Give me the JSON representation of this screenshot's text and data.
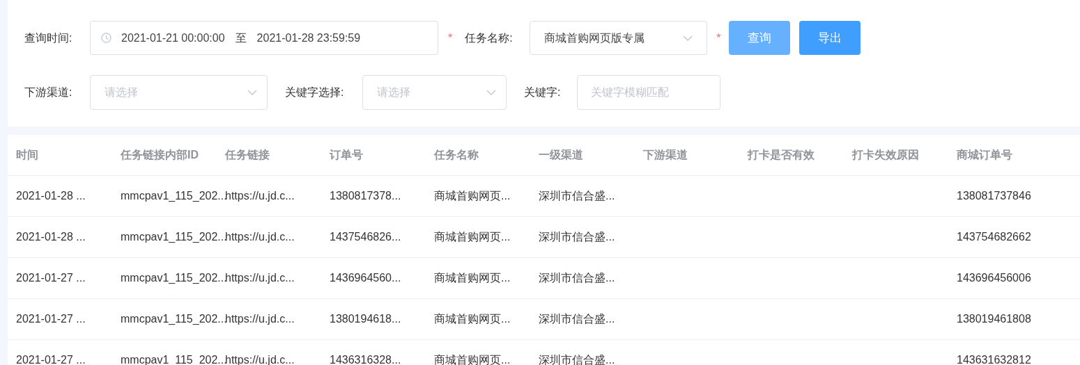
{
  "filters": {
    "time_label": "查询时间:",
    "date_start": "2021-01-21 00:00:00",
    "date_separator": "至",
    "date_end": "2021-01-28 23:59:59",
    "time_required": "*",
    "task_label": "任务名称:",
    "task_value": "商城首购网页版专属",
    "task_required": "*",
    "query_button": "查询",
    "export_button": "导出",
    "channel_label": "下游渠道:",
    "channel_placeholder": "请选择",
    "keyword_select_label": "关键字选择:",
    "keyword_select_placeholder": "请选择",
    "keyword_label": "关键字:",
    "keyword_placeholder": "关键字模糊匹配"
  },
  "table": {
    "columns": [
      "时间",
      "任务链接内部ID",
      "任务链接",
      "订单号",
      "任务名称",
      "一级渠道",
      "下游渠道",
      "打卡是否有效",
      "打卡失效原因",
      "商城订单号"
    ],
    "rows": [
      [
        "2021-01-28 ...",
        "mmcpav1_115_202...",
        "https://u.jd.c...",
        "1380817378...",
        "商城首购网页...",
        "深圳市信合盛...",
        null,
        null,
        null,
        "138081737846"
      ],
      [
        "2021-01-28 ...",
        "mmcpav1_115_202...",
        "https://u.jd.c...",
        "1437546826...",
        "商城首购网页...",
        "深圳市信合盛...",
        null,
        null,
        null,
        "143754682662"
      ],
      [
        "2021-01-27 ...",
        "mmcpav1_115_202...",
        "https://u.jd.c...",
        "1436964560...",
        "商城首购网页...",
        "深圳市信合盛...",
        null,
        null,
        null,
        "143696456006"
      ],
      [
        "2021-01-27 ...",
        "mmcpav1_115_202...",
        "https://u.jd.c...",
        "1380194618...",
        "商城首购网页...",
        "深圳市信合盛...",
        null,
        null,
        null,
        "138019461808"
      ],
      [
        "2021-01-27 ...",
        "mmcpav1_115_202...",
        "https://u.jd.c...",
        "1436316328...",
        "商城首购网页...",
        "深圳市信合盛...",
        null,
        null,
        null,
        "143631632812"
      ]
    ]
  }
}
